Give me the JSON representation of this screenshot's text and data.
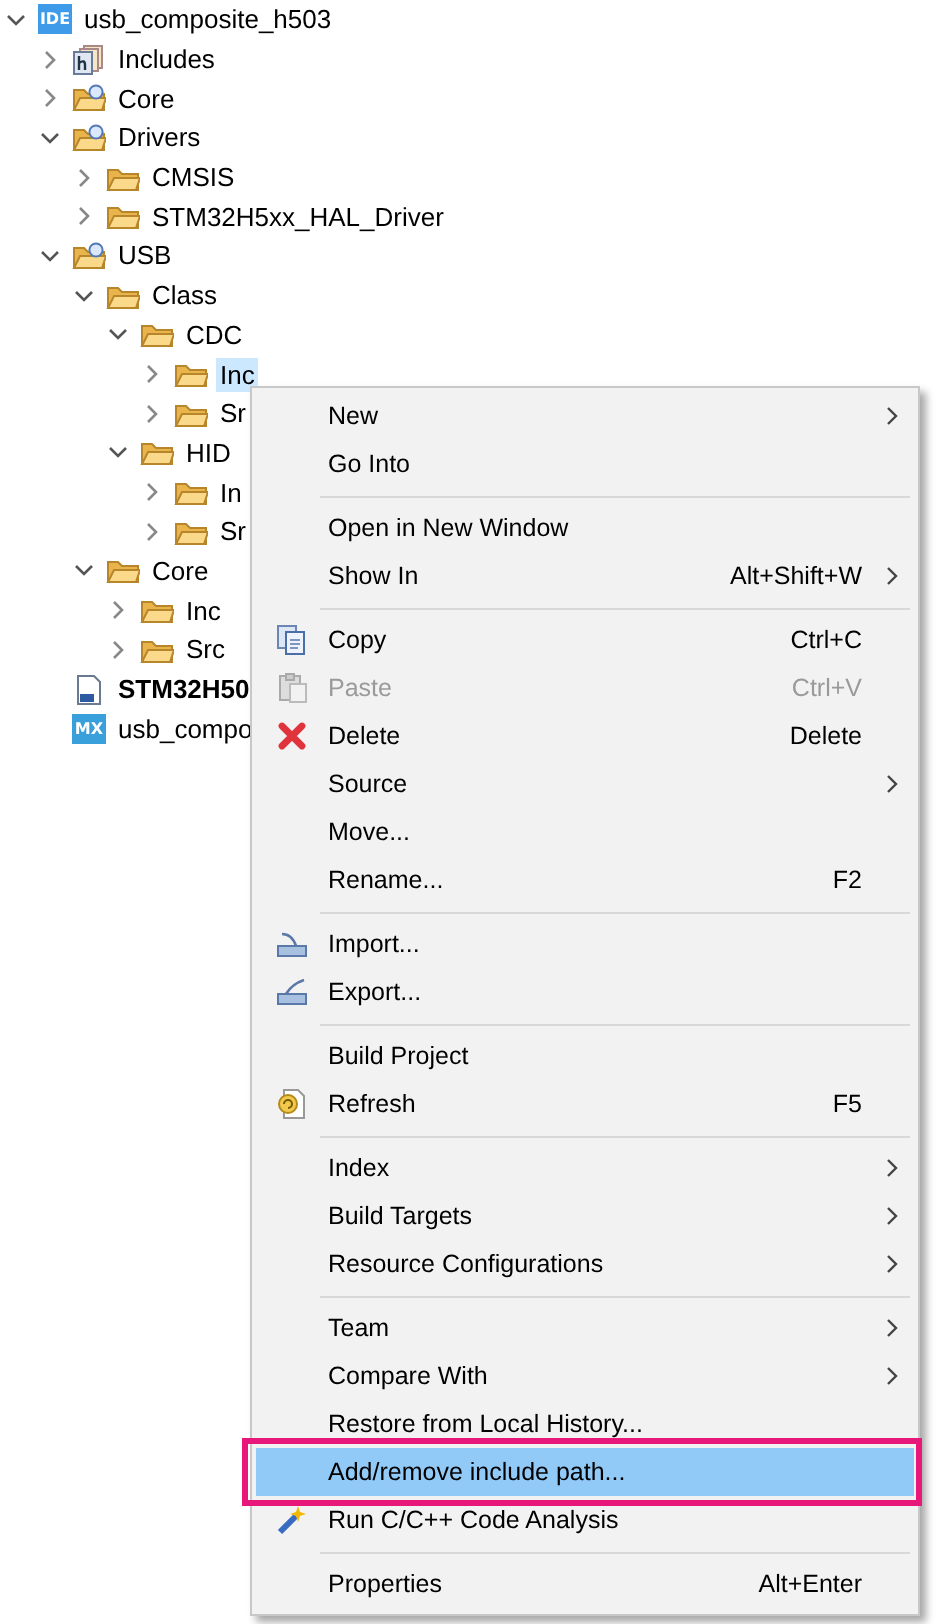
{
  "tree": {
    "root": {
      "label": "usb_composite_h503",
      "kind": "project",
      "badge": "IDE",
      "expanded": true,
      "selected": false,
      "children": [
        {
          "label": "Includes",
          "kind": "includes",
          "expanded": false,
          "selected": false
        },
        {
          "label": "Core",
          "kind": "source-folder",
          "expanded": false,
          "selected": false
        },
        {
          "label": "Drivers",
          "kind": "source-folder",
          "expanded": true,
          "selected": false,
          "children": [
            {
              "label": "CMSIS",
              "kind": "folder",
              "expanded": false,
              "selected": false
            },
            {
              "label": "STM32H5xx_HAL_Driver",
              "kind": "folder",
              "expanded": false,
              "selected": false
            }
          ]
        },
        {
          "label": "USB",
          "kind": "source-folder",
          "expanded": true,
          "selected": false,
          "children": [
            {
              "label": "Class",
              "kind": "folder",
              "expanded": true,
              "selected": false,
              "children": [
                {
                  "label": "CDC",
                  "kind": "folder",
                  "expanded": true,
                  "selected": false,
                  "children": [
                    {
                      "label": "Inc",
                      "kind": "folder",
                      "expanded": false,
                      "selected": true
                    },
                    {
                      "label": "Sr",
                      "kind": "folder",
                      "expanded": false,
                      "selected": false
                    }
                  ]
                },
                {
                  "label": "HID",
                  "kind": "folder",
                  "expanded": true,
                  "selected": false,
                  "children": [
                    {
                      "label": "In",
                      "kind": "folder",
                      "expanded": false,
                      "selected": false
                    },
                    {
                      "label": "Sr",
                      "kind": "folder",
                      "expanded": false,
                      "selected": false
                    }
                  ]
                }
              ]
            },
            {
              "label": "Core",
              "kind": "folder",
              "expanded": true,
              "selected": false,
              "children": [
                {
                  "label": "Inc",
                  "kind": "folder",
                  "expanded": false,
                  "selected": false
                },
                {
                  "label": "Src",
                  "kind": "folder",
                  "expanded": false,
                  "selected": false
                }
              ]
            }
          ]
        },
        {
          "label": "STM32H50",
          "kind": "ld-file",
          "selected": false
        },
        {
          "label": "usb_compo",
          "kind": "mx-file",
          "badge": "MX",
          "selected": false
        }
      ]
    }
  },
  "menu": {
    "items": [
      {
        "kind": "item",
        "label": "New",
        "submenu": true,
        "disabled": false,
        "selected": false
      },
      {
        "kind": "item",
        "label": "Go Into",
        "submenu": false,
        "disabled": false,
        "selected": false
      },
      {
        "kind": "separator"
      },
      {
        "kind": "item",
        "label": "Open in New Window",
        "submenu": false,
        "disabled": false,
        "selected": false
      },
      {
        "kind": "item",
        "label": "Show In",
        "shortcut": "Alt+Shift+W",
        "submenu": true,
        "disabled": false,
        "selected": false
      },
      {
        "kind": "separator"
      },
      {
        "kind": "item",
        "label": "Copy",
        "shortcut": "Ctrl+C",
        "submenu": false,
        "disabled": false,
        "selected": false
      },
      {
        "kind": "item",
        "label": "Paste",
        "shortcut": "Ctrl+V",
        "submenu": false,
        "disabled": true,
        "selected": false
      },
      {
        "kind": "item",
        "label": "Delete",
        "shortcut": "Delete",
        "submenu": false,
        "disabled": false,
        "selected": false
      },
      {
        "kind": "item",
        "label": "Source",
        "submenu": true,
        "disabled": false,
        "selected": false
      },
      {
        "kind": "item",
        "label": "Move...",
        "submenu": false,
        "disabled": false,
        "selected": false
      },
      {
        "kind": "item",
        "label": "Rename...",
        "shortcut": "F2",
        "submenu": false,
        "disabled": false,
        "selected": false
      },
      {
        "kind": "separator"
      },
      {
        "kind": "item",
        "label": "Import...",
        "submenu": false,
        "disabled": false,
        "selected": false
      },
      {
        "kind": "item",
        "label": "Export...",
        "submenu": false,
        "disabled": false,
        "selected": false
      },
      {
        "kind": "separator"
      },
      {
        "kind": "item",
        "label": "Build Project",
        "submenu": false,
        "disabled": false,
        "selected": false
      },
      {
        "kind": "item",
        "label": "Refresh",
        "shortcut": "F5",
        "submenu": false,
        "disabled": false,
        "selected": false
      },
      {
        "kind": "separator"
      },
      {
        "kind": "item",
        "label": "Index",
        "submenu": true,
        "disabled": false,
        "selected": false
      },
      {
        "kind": "item",
        "label": "Build Targets",
        "submenu": true,
        "disabled": false,
        "selected": false
      },
      {
        "kind": "item",
        "label": "Resource Configurations",
        "submenu": true,
        "disabled": false,
        "selected": false
      },
      {
        "kind": "separator"
      },
      {
        "kind": "item",
        "label": "Team",
        "submenu": true,
        "disabled": false,
        "selected": false
      },
      {
        "kind": "item",
        "label": "Compare With",
        "submenu": true,
        "disabled": false,
        "selected": false
      },
      {
        "kind": "item",
        "label": "Restore from Local History...",
        "submenu": false,
        "disabled": false,
        "selected": false
      },
      {
        "kind": "item",
        "label": "Add/remove include path...",
        "submenu": false,
        "disabled": false,
        "selected": true,
        "callout": true
      },
      {
        "kind": "item",
        "label": "Run C/C++ Code Analysis",
        "submenu": false,
        "disabled": false,
        "selected": false
      },
      {
        "kind": "separator"
      },
      {
        "kind": "item",
        "label": "Properties",
        "shortcut": "Alt+Enter",
        "submenu": false,
        "disabled": false,
        "selected": false
      }
    ]
  }
}
